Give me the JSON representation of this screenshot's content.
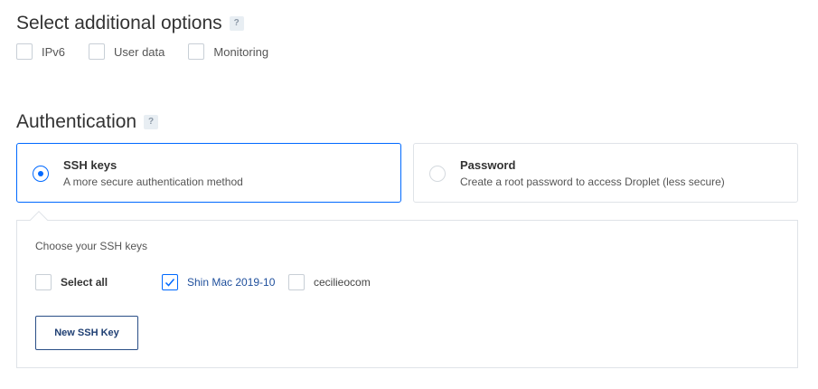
{
  "additional_options": {
    "title": "Select additional options",
    "help": "?",
    "options": [
      {
        "label": "IPv6",
        "checked": false
      },
      {
        "label": "User data",
        "checked": false
      },
      {
        "label": "Monitoring",
        "checked": false
      }
    ]
  },
  "authentication": {
    "title": "Authentication",
    "help": "?",
    "methods": [
      {
        "title": "SSH keys",
        "description": "A more secure authentication method",
        "selected": true
      },
      {
        "title": "Password",
        "description": "Create a root password to access Droplet (less secure)",
        "selected": false
      }
    ]
  },
  "ssh_keys": {
    "label": "Choose your SSH keys",
    "select_all_label": "Select all",
    "keys": [
      {
        "name": "Shin Mac 2019-10",
        "checked": true
      },
      {
        "name": "cecilieocom",
        "checked": false
      }
    ],
    "new_key_button": "New SSH Key"
  },
  "colors": {
    "accent": "#0069ff",
    "selected_key_text": "#1f4f9c",
    "button_border": "#2a4e86"
  }
}
